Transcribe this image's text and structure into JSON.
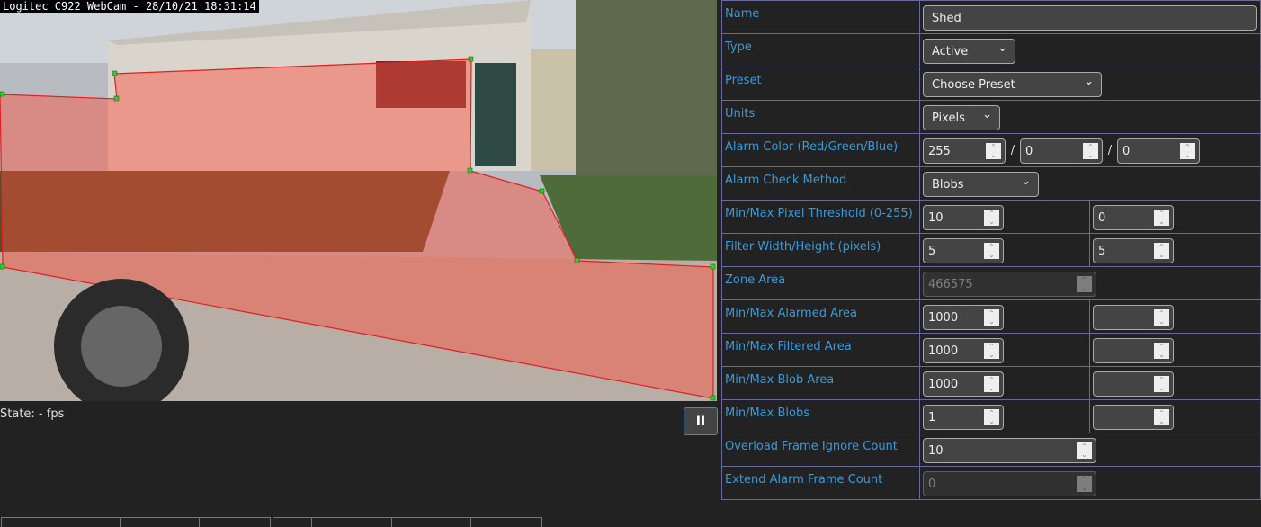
{
  "camera": {
    "caption": "Logitec C922 WebCam - 28/10/21 18:31:14",
    "zone_color": "#ff0000"
  },
  "status": {
    "state_text": "State:  -  fps"
  },
  "controls": {
    "pause_label": "II"
  },
  "zone": {
    "name_label": "Name",
    "name": "Shed",
    "type_label": "Type",
    "type": "Active",
    "preset_label": "Preset",
    "preset": "Choose Preset",
    "units_label": "Units",
    "units": "Pixels",
    "alarm_color_label": "Alarm Color (Red/Green/Blue)",
    "red": "255",
    "green": "0",
    "blue": "0",
    "sep": "/",
    "check_method_label": "Alarm Check Method",
    "check_method": "Blobs",
    "pixel_threshold_label": "Min/Max Pixel Threshold (0-255)",
    "pixel_min": "10",
    "pixel_max": "0",
    "filter_label": "Filter Width/Height (pixels)",
    "filter_w": "5",
    "filter_h": "5",
    "area_label": "Zone Area",
    "area": "466575",
    "alarmed_label": "Min/Max Alarmed Area",
    "alarmed_min": "1000",
    "alarmed_max": "",
    "filtered_label": "Min/Max Filtered Area",
    "filtered_min": "1000",
    "filtered_max": "",
    "blob_area_label": "Min/Max Blob Area",
    "blob_area_min": "1000",
    "blob_area_max": "",
    "blobs_label": "Min/Max Blobs",
    "blobs_min": "1",
    "blobs_max": "",
    "overload_label": "Overload Frame Ignore Count",
    "overload": "10",
    "extend_label": "Extend Alarm Frame Count",
    "extend": "0"
  }
}
